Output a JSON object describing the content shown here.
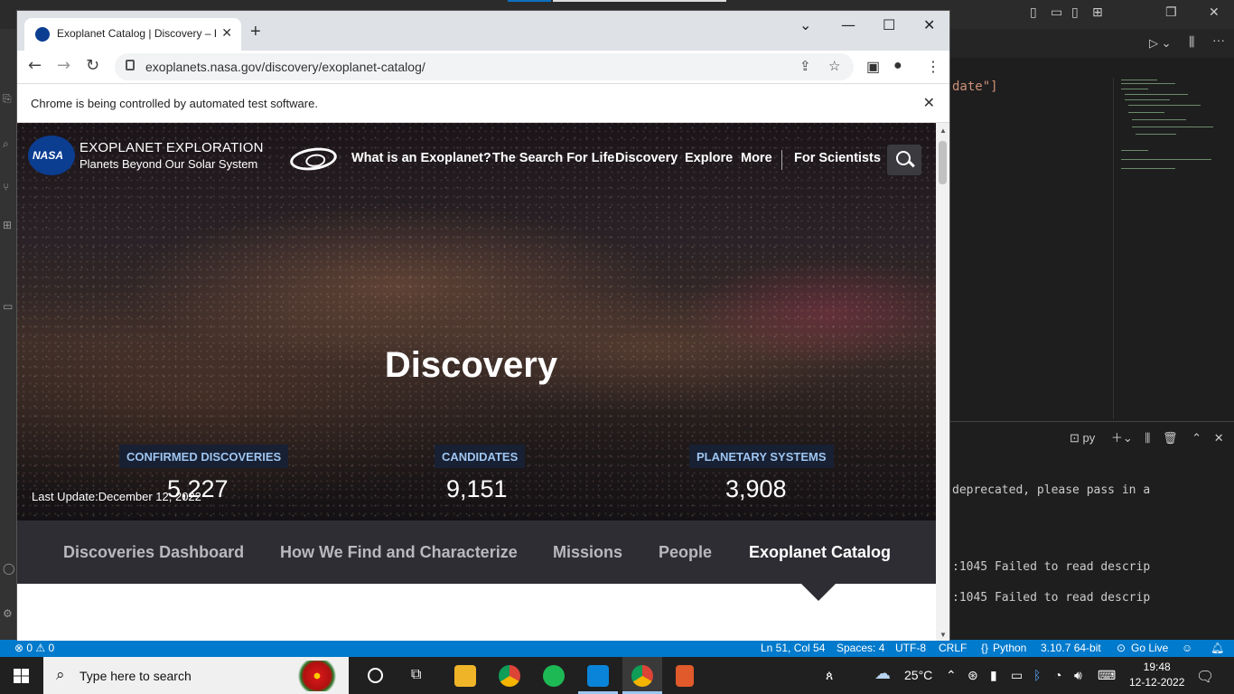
{
  "browser": {
    "tab_title": "Exoplanet Catalog | Discovery – E",
    "url": "exoplanets.nasa.gov/discovery/exoplanet-catalog/",
    "automation_banner": "Chrome is being controlled by automated test software."
  },
  "site": {
    "logo_text": "NASA",
    "brand_title": "EXOPLANET EXPLORATION",
    "brand_subtitle": "Planets Beyond Our Solar System",
    "nav": [
      "What is an Exoplanet?",
      "The Search For Life",
      "Discovery",
      "Explore",
      "More",
      "For Scientists"
    ],
    "hero_title": "Discovery",
    "stats": [
      {
        "label": "CONFIRMED DISCOVERIES",
        "value": "5,227"
      },
      {
        "label": "CANDIDATES",
        "value": "9,151"
      },
      {
        "label": "PLANETARY SYSTEMS",
        "value": "3,908"
      }
    ],
    "last_update": "Last Update:December 12, 2022",
    "subnav": [
      "Discoveries Dashboard",
      "How We Find and Characterize",
      "Missions",
      "People",
      "Exoplanet Catalog"
    ],
    "active_subnav": "Exoplanet Catalog"
  },
  "vscode": {
    "code_fragment": "date\"]",
    "terminal_label": "py",
    "terminal_lines": [
      "deprecated, please pass in a",
      ":1045 Failed to read descrip",
      ":1045 Failed to read descrip"
    ],
    "status": {
      "problems": "⊗ 0 ⚠ 0",
      "position": "Ln 51, Col 54",
      "spaces": "Spaces: 4",
      "encoding": "UTF-8",
      "eol": "CRLF",
      "language": "Python",
      "interpreter": "3.10.7 64-bit",
      "golive": "Go Live"
    }
  },
  "taskbar": {
    "search_placeholder": "Type here to search",
    "temperature": "25°C",
    "time": "19:48",
    "date": "12-12-2022"
  },
  "colors": {
    "nasa_blue": "#0b3d91",
    "stat_label": "#9ec5f0",
    "vscode_status": "#007acc"
  }
}
